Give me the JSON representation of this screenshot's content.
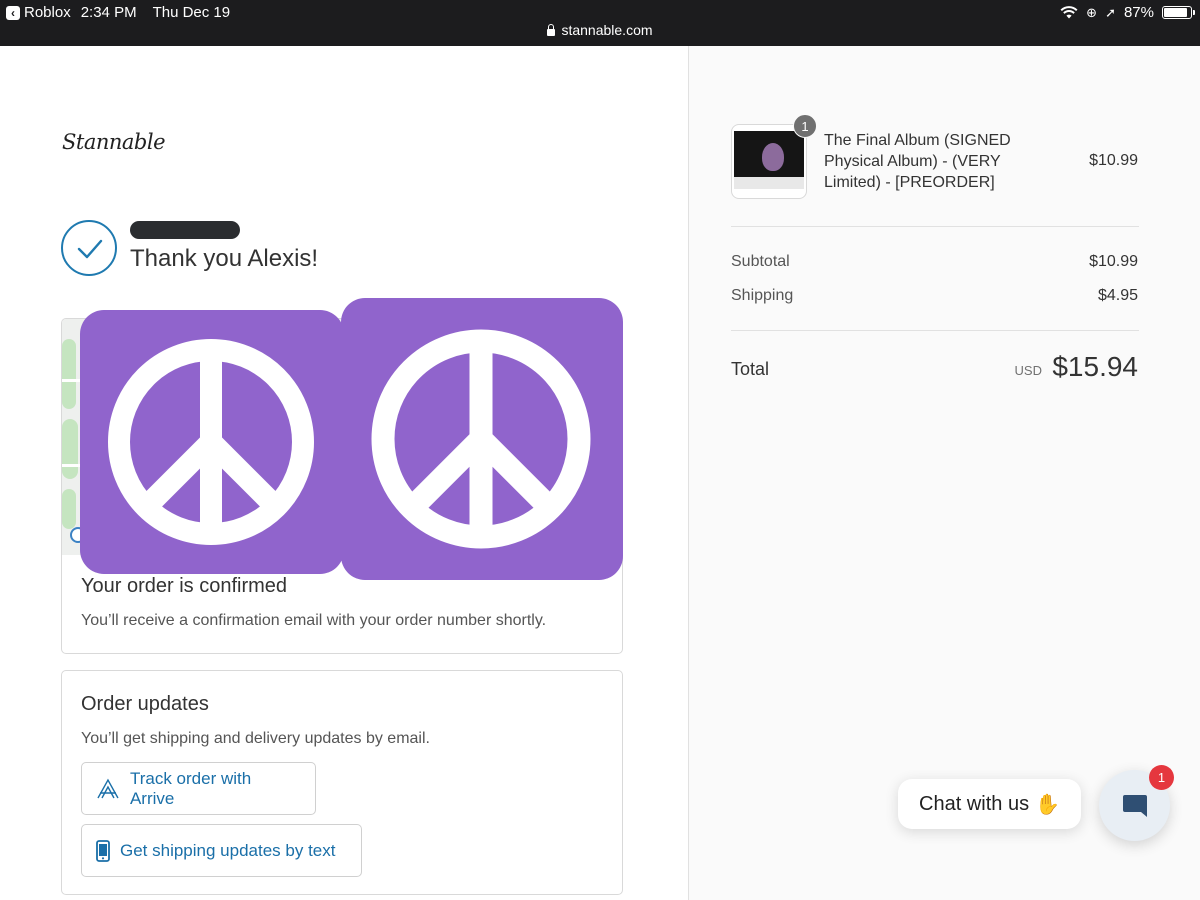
{
  "status_bar": {
    "back_app": "Roblox",
    "time": "2:34 PM",
    "date": "Thu Dec 19",
    "url": "stannable.com",
    "battery": "87%",
    "battery_level": 0.87
  },
  "brand": {
    "logo_text": "Stannable"
  },
  "greeting": {
    "title": "Thank you Alexis!"
  },
  "confirmation": {
    "title": "Your order is confirmed",
    "text": "You’ll receive a confirmation email with your order number shortly."
  },
  "updates": {
    "title": "Order updates",
    "text": "You’ll get shipping and delivery updates by email.",
    "track_button": "Track order with Arrive",
    "sms_button": "Get shipping updates by text"
  },
  "summary": {
    "item": {
      "quantity": "1",
      "name": "The Final Album (SIGNED Physical Album) - (VERY Limited) - [PREORDER]",
      "price": "$10.99"
    },
    "subtotal_label": "Subtotal",
    "subtotal_value": "$10.99",
    "shipping_label": "Shipping",
    "shipping_value": "$4.95",
    "total_label": "Total",
    "total_currency": "USD",
    "total_value": "$15.94"
  },
  "chat": {
    "label": "Chat with us",
    "unread_count": "1"
  },
  "colors": {
    "accent": "#1f7ab0",
    "link": "#1a6fa8",
    "overlay": "#9064cc",
    "badge": "#e5373e"
  }
}
